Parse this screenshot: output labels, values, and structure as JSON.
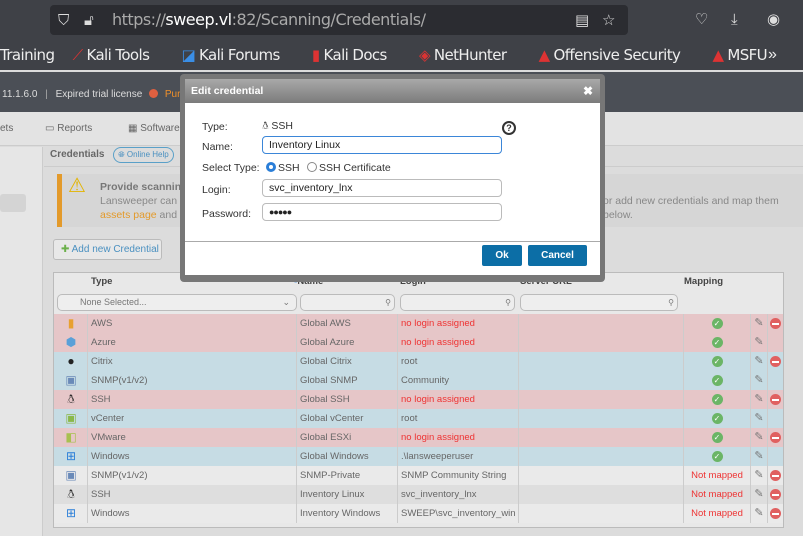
{
  "browser": {
    "url_prefix": "https://",
    "url_host": "sweep.vl",
    "url_rest": ":82/Scanning/Credentials/",
    "bookmarks": [
      "Training",
      "Kali Tools",
      "Kali Forums",
      "Kali Docs",
      "NetHunter",
      "Offensive Security",
      "MSFU"
    ],
    "more": "»"
  },
  "app": {
    "version": "11.1.6.0",
    "license": "Expired trial license",
    "purchase": "Purch",
    "nav": [
      "ets",
      "Reports",
      "Software"
    ]
  },
  "page": {
    "title": "Credentials",
    "help": "Online Help",
    "alert_title": "Provide scanning",
    "alert_line1": "Lansweeper can sc",
    "alert_line1_end": "or add new credentials and map them below.",
    "alert_link": "assets page",
    "alert_line2": " and res",
    "add_button": "Add new Credential"
  },
  "table": {
    "headers": {
      "type": "Type",
      "name": "Name",
      "login": "Login",
      "server": "Server URL",
      "mapping": "Mapping"
    },
    "type_filter": "None Selected...",
    "rows": [
      {
        "type": "AWS",
        "name": "Global AWS",
        "login": "no login assigned",
        "mapping": "ok",
        "status": "red",
        "deletable": true,
        "icon": "aws-icon"
      },
      {
        "type": "Azure",
        "name": "Global Azure",
        "login": "no login assigned",
        "mapping": "ok",
        "status": "red",
        "deletable": false,
        "icon": "azure-icon"
      },
      {
        "type": "Citrix",
        "name": "Global Citrix",
        "login": "root",
        "mapping": "ok",
        "status": "blue",
        "deletable": true,
        "icon": "citrix-icon"
      },
      {
        "type": "SNMP(v1/v2)",
        "name": "Global SNMP",
        "login": "Community",
        "mapping": "ok",
        "status": "blue",
        "deletable": false,
        "icon": "snmp-icon"
      },
      {
        "type": "SSH",
        "name": "Global SSH",
        "login": "no login assigned",
        "mapping": "ok",
        "status": "red",
        "deletable": true,
        "icon": "linux-icon"
      },
      {
        "type": "vCenter",
        "name": "Global vCenter",
        "login": "root",
        "mapping": "ok",
        "status": "blue",
        "deletable": false,
        "icon": "vcenter-icon"
      },
      {
        "type": "VMware",
        "name": "Global ESXi",
        "login": "no login assigned",
        "mapping": "ok",
        "status": "red",
        "deletable": true,
        "icon": "vmware-icon"
      },
      {
        "type": "Windows",
        "name": "Global Windows",
        "login": ".\\lansweeperuser",
        "mapping": "ok",
        "status": "blue",
        "deletable": false,
        "icon": "windows-icon"
      },
      {
        "type": "SNMP(v1/v2)",
        "name": "SNMP-Private",
        "login": "SNMP Community String",
        "mapping": "Not mapped",
        "status": "g1",
        "deletable": true,
        "icon": "snmp-icon"
      },
      {
        "type": "SSH",
        "name": "Inventory Linux",
        "login": "svc_inventory_lnx",
        "mapping": "Not mapped",
        "status": "g2",
        "deletable": true,
        "icon": "linux-icon"
      },
      {
        "type": "Windows",
        "name": "Inventory Windows",
        "login": "SWEEP\\svc_inventory_win",
        "mapping": "Not mapped",
        "status": "g1",
        "deletable": true,
        "icon": "windows-icon"
      }
    ]
  },
  "dialog": {
    "title": "Edit credential",
    "type_label": "Type:",
    "type_value": "SSH",
    "name_label": "Name:",
    "name_value": "Inventory Linux",
    "select_type_label": "Select Type:",
    "options": [
      "SSH",
      "SSH Certificate"
    ],
    "selected": "SSH",
    "login_label": "Login:",
    "login_value": "svc_inventory_lnx",
    "password_label": "Password:",
    "password_value": "●●●●●",
    "ok": "Ok",
    "cancel": "Cancel"
  }
}
